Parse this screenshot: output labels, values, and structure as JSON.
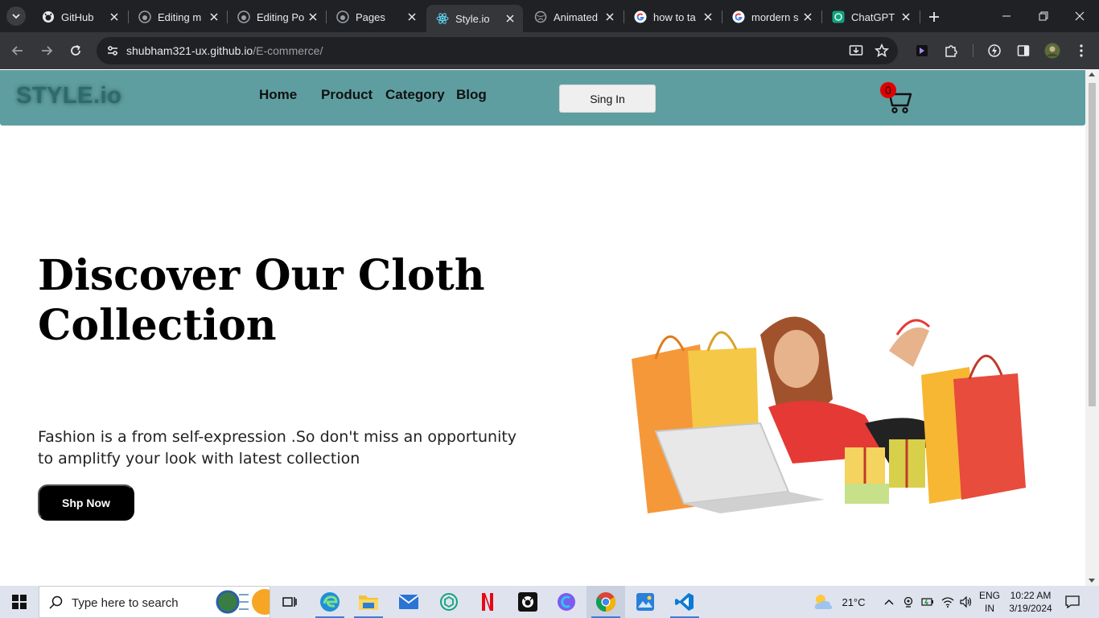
{
  "browser": {
    "tabs": [
      {
        "title": "GitHub",
        "favicon": "github-icon",
        "active": false
      },
      {
        "title": "Editing m",
        "favicon": "github-icon",
        "active": false
      },
      {
        "title": "Editing Po",
        "favicon": "github-icon",
        "active": false
      },
      {
        "title": "Pages",
        "favicon": "github-icon",
        "active": false
      },
      {
        "title": "Style.io",
        "favicon": "react-icon",
        "active": true
      },
      {
        "title": "Animated",
        "favicon": "globe-icon",
        "active": false
      },
      {
        "title": "how to ta",
        "favicon": "google-icon",
        "active": false
      },
      {
        "title": "mordern s",
        "favicon": "google-icon",
        "active": false
      },
      {
        "title": "ChatGPT",
        "favicon": "chatgpt-icon",
        "active": false
      }
    ],
    "url_host": "shubham321-ux.github.io",
    "url_path": "/E-commerce/"
  },
  "site": {
    "logo": "STYLE.io",
    "nav": [
      "Home",
      "Product",
      "Category",
      "Blog"
    ],
    "signin_label": "Sing In",
    "cart_count": "0",
    "hero_title": "Discover Our Cloth Collection",
    "hero_text": "Fashion is a from self-expression .So don't miss an opportunity to amplitfy your look with latest collection",
    "shop_label": "Shp Now",
    "colors": {
      "navbar": "#5f9ea0",
      "logo": "#2c6b6e",
      "badge": "#e00000"
    }
  },
  "taskbar": {
    "search_placeholder": "Type here to search",
    "weather": "21°C",
    "lang_line1": "ENG",
    "lang_line2": "IN",
    "time": "10:22 AM",
    "date": "3/19/2024",
    "apps": [
      "task-view-icon",
      "edge-icon",
      "file-explorer-icon",
      "mail-icon",
      "chatgpt-icon",
      "netflix-icon",
      "github-desktop-icon",
      "copilot-icon",
      "chrome-icon",
      "photos-icon",
      "vscode-icon"
    ]
  }
}
